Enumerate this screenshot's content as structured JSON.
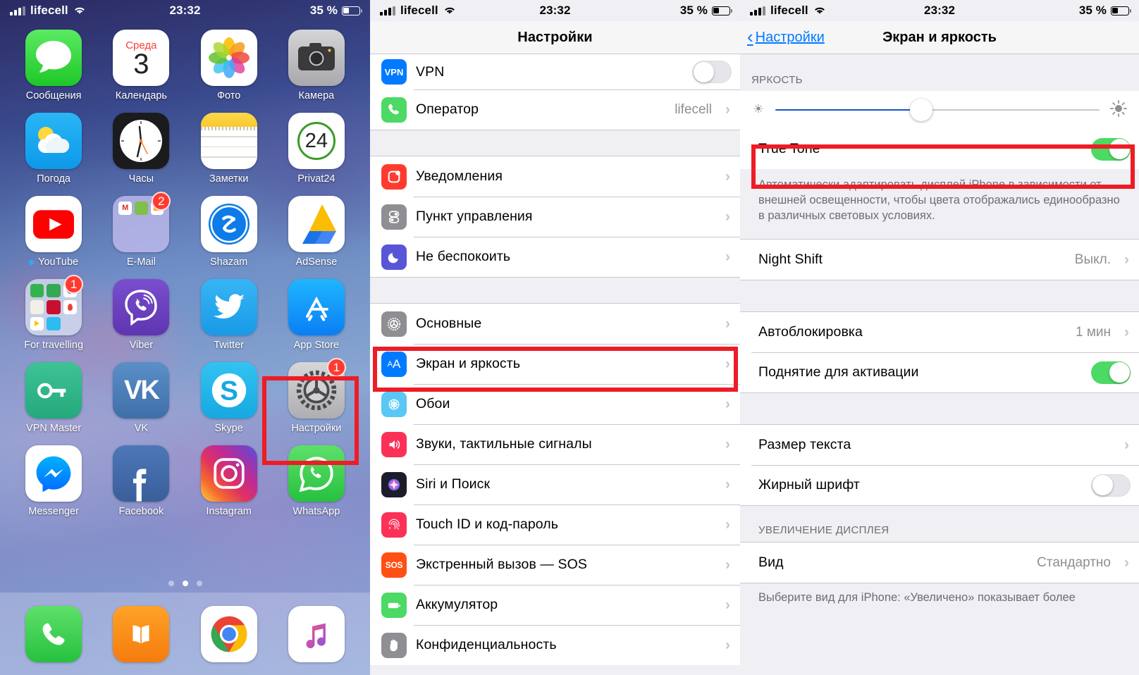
{
  "status_bar": {
    "carrier": "lifecell",
    "time": "23:32",
    "battery_percent": "35 %",
    "signal_icon": "cellular-signal-icon",
    "wifi_icon": "wifi-icon",
    "battery_icon": "battery-icon"
  },
  "home_screen": {
    "apps": [
      {
        "label": "Сообщения",
        "icon": "messages-icon",
        "badge": ""
      },
      {
        "label": "Календарь",
        "icon": "calendar-icon",
        "badge": "",
        "weekday": "Среда",
        "day": "3"
      },
      {
        "label": "Фото",
        "icon": "photos-icon",
        "badge": ""
      },
      {
        "label": "Камера",
        "icon": "camera-icon",
        "badge": ""
      },
      {
        "label": "Погода",
        "icon": "weather-icon",
        "badge": ""
      },
      {
        "label": "Часы",
        "icon": "clock-icon",
        "badge": ""
      },
      {
        "label": "Заметки",
        "icon": "notes-icon",
        "badge": ""
      },
      {
        "label": "Privat24",
        "icon": "privat24-icon",
        "badge": "",
        "text": "24"
      },
      {
        "label": "YouTube",
        "icon": "youtube-icon",
        "badge": "",
        "dot": true
      },
      {
        "label": "E-Mail",
        "icon": "folder-icon",
        "badge": "2"
      },
      {
        "label": "Shazam",
        "icon": "shazam-icon",
        "badge": ""
      },
      {
        "label": "AdSense",
        "icon": "adsense-icon",
        "badge": ""
      },
      {
        "label": "For travelling",
        "icon": "folder-icon",
        "badge": "1"
      },
      {
        "label": "Viber",
        "icon": "viber-icon",
        "badge": ""
      },
      {
        "label": "Twitter",
        "icon": "twitter-icon",
        "badge": ""
      },
      {
        "label": "App Store",
        "icon": "app-store-icon",
        "badge": ""
      },
      {
        "label": "VPN Master",
        "icon": "vpn-master-icon",
        "badge": ""
      },
      {
        "label": "VK",
        "icon": "vk-icon",
        "badge": ""
      },
      {
        "label": "Skype",
        "icon": "skype-icon",
        "badge": ""
      },
      {
        "label": "Настройки",
        "icon": "settings-gear-icon",
        "badge": "1"
      },
      {
        "label": "Messenger",
        "icon": "messenger-icon",
        "badge": ""
      },
      {
        "label": "Facebook",
        "icon": "facebook-icon",
        "badge": ""
      },
      {
        "label": "Instagram",
        "icon": "instagram-icon",
        "badge": ""
      },
      {
        "label": "WhatsApp",
        "icon": "whatsapp-icon",
        "badge": ""
      }
    ],
    "dock": [
      {
        "label": "Телефон",
        "icon": "phone-icon"
      },
      {
        "label": "Книги",
        "icon": "books-icon"
      },
      {
        "label": "Chrome",
        "icon": "chrome-icon"
      },
      {
        "label": "Музыка",
        "icon": "music-icon"
      }
    ],
    "page_dots": {
      "count": 3,
      "active_index": 1
    }
  },
  "settings_panel": {
    "title": "Настройки",
    "rows": [
      {
        "label": "VPN",
        "icon": "vpn-icon",
        "icon_text": "VPN",
        "type": "toggle",
        "toggle_on": false
      },
      {
        "label": "Оператор",
        "icon": "carrier-phone-icon",
        "type": "value",
        "value": "lifecell"
      },
      {
        "label": "Уведомления",
        "icon": "notifications-icon",
        "type": "chevron"
      },
      {
        "label": "Пункт управления",
        "icon": "control-center-icon",
        "type": "chevron"
      },
      {
        "label": "Не беспокоить",
        "icon": "do-not-disturb-icon",
        "type": "chevron"
      },
      {
        "label": "Основные",
        "icon": "general-gear-icon",
        "type": "chevron"
      },
      {
        "label": "Экран и яркость",
        "icon": "display-brightness-icon",
        "icon_text": "AA",
        "type": "chevron",
        "highlighted": true
      },
      {
        "label": "Обои",
        "icon": "wallpaper-icon",
        "type": "chevron"
      },
      {
        "label": "Звуки, тактильные сигналы",
        "icon": "sounds-icon",
        "type": "chevron"
      },
      {
        "label": "Siri и Поиск",
        "icon": "siri-icon",
        "type": "chevron"
      },
      {
        "label": "Touch ID и код-пароль",
        "icon": "touch-id-icon",
        "type": "chevron"
      },
      {
        "label": "Экстренный вызов — SOS",
        "icon": "sos-icon",
        "icon_text": "SOS",
        "type": "chevron"
      },
      {
        "label": "Аккумулятор",
        "icon": "battery-settings-icon",
        "type": "chevron"
      },
      {
        "label": "Конфиденциальность",
        "icon": "privacy-hand-icon",
        "type": "chevron"
      }
    ]
  },
  "display_panel": {
    "back_label": "Настройки",
    "title": "Экран и яркость",
    "brightness_header": "ЯРКОСТЬ",
    "brightness_value": 45,
    "sun_low_icon": "sun-low-icon",
    "sun_high_icon": "sun-high-icon",
    "true_tone": {
      "label": "True Tone",
      "on": true,
      "highlighted": true
    },
    "true_tone_note": "Автоматически адаптировать дисплей iPhone в зависимости от внешней освещенности, чтобы цвета отображались единообразно в различных световых условиях.",
    "night_shift": {
      "label": "Night Shift",
      "value": "Выкл."
    },
    "auto_lock": {
      "label": "Автоблокировка",
      "value": "1 мин"
    },
    "raise_to_wake": {
      "label": "Поднятие для активации",
      "on": true
    },
    "text_size": {
      "label": "Размер текста"
    },
    "bold_text": {
      "label": "Жирный шрифт",
      "on": false
    },
    "zoom_header": "УВЕЛИЧЕНИЕ ДИСПЛЕЯ",
    "view": {
      "label": "Вид",
      "value": "Стандартно"
    },
    "view_note": "Выберите вид для iPhone: «Увеличено» показывает более"
  },
  "colors": {
    "highlight_red": "#ee1c25",
    "ios_blue": "#007aff",
    "toggle_green": "#4cd964",
    "slider_blue": "#1554c9"
  }
}
